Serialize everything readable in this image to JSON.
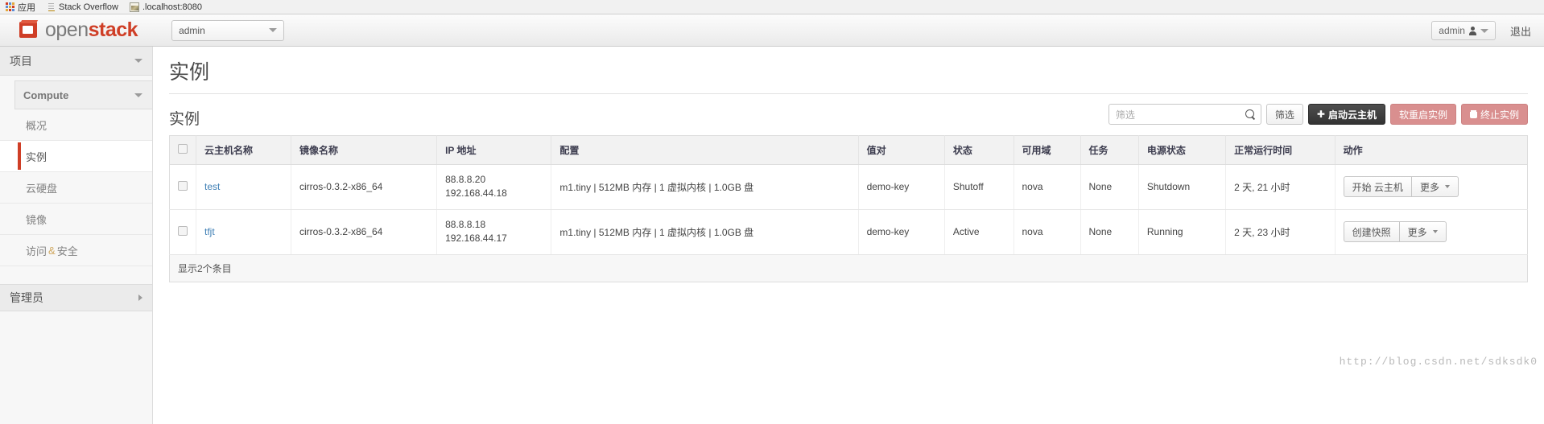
{
  "browser": {
    "bookmarks": [
      {
        "label": "应用",
        "icon": "apps-grid-icon"
      },
      {
        "label": "Stack Overflow",
        "icon": "stack-overflow-icon"
      },
      {
        "label": ".localhost:8080",
        "icon": "site-favicon-icon"
      }
    ]
  },
  "navbar": {
    "brand_open": "open",
    "brand_stack": "stack",
    "tenant_selected": "admin",
    "user_name": "admin",
    "logout_label": "退出"
  },
  "sidebar": {
    "project_group": "项目",
    "compute_group": "Compute",
    "items": [
      {
        "label": "概况",
        "active": false
      },
      {
        "label": "实例",
        "active": true
      },
      {
        "label": "云硬盘",
        "active": false
      },
      {
        "label": "镜像",
        "active": false
      }
    ],
    "access_label_left": "访问",
    "access_amp": "&",
    "access_label_right": "安全",
    "admin_group": "管理员"
  },
  "content": {
    "page_title": "实例",
    "panel_title": "实例",
    "search_placeholder": "筛选",
    "search_value": "",
    "filter_button": "筛选",
    "launch_button": "启动云主机",
    "soft_reboot_button": "软重启实例",
    "terminate_button": "终止实例",
    "footer_text": "显示2个条目",
    "watermark": "http://blog.csdn.net/sdksdk0"
  },
  "table": {
    "columns": [
      "云主机名称",
      "镜像名称",
      "IP 地址",
      "配置",
      "值对",
      "状态",
      "可用域",
      "任务",
      "电源状态",
      "正常运行时间",
      "动作"
    ],
    "rows": [
      {
        "name": "test",
        "image": "cirros-0.3.2-x86_64",
        "ip_floating": "88.8.8.20",
        "ip_fixed": "192.168.44.18",
        "flavor": "m1.tiny | 512MB 内存 | 1 虚拟内核 | 1.0GB 盘",
        "keypair": "demo-key",
        "status": "Shutoff",
        "zone": "nova",
        "task": "None",
        "power": "Shutdown",
        "uptime": "2 天, 21 小时",
        "primary_action": "开始 云主机",
        "more_action": "更多"
      },
      {
        "name": "tfjt",
        "image": "cirros-0.3.2-x86_64",
        "ip_floating": "88.8.8.18",
        "ip_fixed": "192.168.44.17",
        "flavor": "m1.tiny | 512MB 内存 | 1 虚拟内核 | 1.0GB 盘",
        "keypair": "demo-key",
        "status": "Active",
        "zone": "nova",
        "task": "None",
        "power": "Running",
        "uptime": "2 天, 23 小时",
        "primary_action": "创建快照",
        "more_action": "更多"
      }
    ]
  },
  "colors": {
    "brand_red": "#cf3e26",
    "link_blue": "#3f7fb5",
    "danger": "#d98f8f",
    "dark_button": "#333333"
  }
}
